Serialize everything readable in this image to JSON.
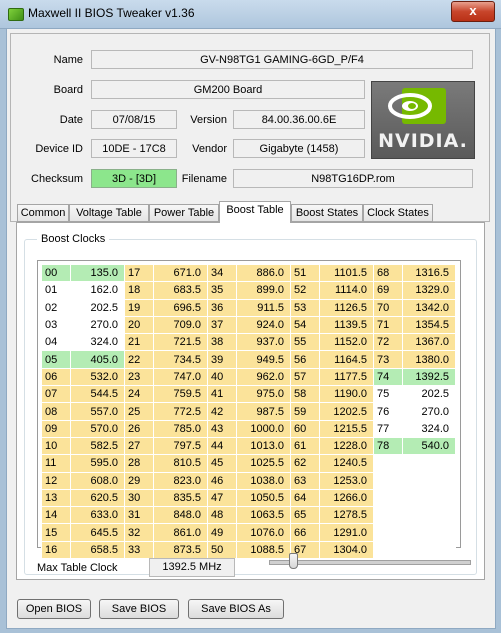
{
  "window": {
    "title": "Maxwell II BIOS Tweaker v1.36",
    "close_glyph": "x"
  },
  "info": {
    "name_label": "Name",
    "name_value": "GV-N98TG1 GAMING-6GD_P/F4",
    "board_label": "Board",
    "board_value": "GM200 Board",
    "date_label": "Date",
    "date_value": "07/08/15",
    "version_label": "Version",
    "version_value": "84.00.36.00.6E",
    "device_id_label": "Device ID",
    "device_id_value": "10DE - 17C8",
    "vendor_label": "Vendor",
    "vendor_value": "Gigabyte (1458)",
    "checksum_label": "Checksum",
    "checksum_value": "3D - [3D]",
    "filename_label": "Filename",
    "filename_value": "N98TG16DP.rom",
    "logo_text": "NVIDIA."
  },
  "tabs": [
    {
      "label": "Common"
    },
    {
      "label": "Voltage Table"
    },
    {
      "label": "Power Table"
    },
    {
      "label": "Boost Table",
      "active": true
    },
    {
      "label": "Boost States"
    },
    {
      "label": "Clock States"
    }
  ],
  "boost_table": {
    "group_title": "Boost Clocks",
    "rows": [
      [
        [
          "00",
          "135.0",
          "g"
        ],
        [
          "17",
          "671.0",
          "y"
        ],
        [
          "34",
          "886.0",
          "y"
        ],
        [
          "51",
          "1101.5",
          "y"
        ],
        [
          "68",
          "1316.5",
          "y"
        ]
      ],
      [
        [
          "01",
          "162.0",
          "w"
        ],
        [
          "18",
          "683.5",
          "y"
        ],
        [
          "35",
          "899.0",
          "y"
        ],
        [
          "52",
          "1114.0",
          "y"
        ],
        [
          "69",
          "1329.0",
          "y"
        ]
      ],
      [
        [
          "02",
          "202.5",
          "w"
        ],
        [
          "19",
          "696.5",
          "y"
        ],
        [
          "36",
          "911.5",
          "y"
        ],
        [
          "53",
          "1126.5",
          "y"
        ],
        [
          "70",
          "1342.0",
          "y"
        ]
      ],
      [
        [
          "03",
          "270.0",
          "w"
        ],
        [
          "20",
          "709.0",
          "y"
        ],
        [
          "37",
          "924.0",
          "y"
        ],
        [
          "54",
          "1139.5",
          "y"
        ],
        [
          "71",
          "1354.5",
          "y"
        ]
      ],
      [
        [
          "04",
          "324.0",
          "w"
        ],
        [
          "21",
          "721.5",
          "y"
        ],
        [
          "38",
          "937.0",
          "y"
        ],
        [
          "55",
          "1152.0",
          "y"
        ],
        [
          "72",
          "1367.0",
          "y"
        ]
      ],
      [
        [
          "05",
          "405.0",
          "g"
        ],
        [
          "22",
          "734.5",
          "y"
        ],
        [
          "39",
          "949.5",
          "y"
        ],
        [
          "56",
          "1164.5",
          "y"
        ],
        [
          "73",
          "1380.0",
          "y"
        ]
      ],
      [
        [
          "06",
          "532.0",
          "y"
        ],
        [
          "23",
          "747.0",
          "y"
        ],
        [
          "40",
          "962.0",
          "y"
        ],
        [
          "57",
          "1177.5",
          "y"
        ],
        [
          "74",
          "1392.5",
          "g"
        ]
      ],
      [
        [
          "07",
          "544.5",
          "y"
        ],
        [
          "24",
          "759.5",
          "y"
        ],
        [
          "41",
          "975.0",
          "y"
        ],
        [
          "58",
          "1190.0",
          "y"
        ],
        [
          "75",
          "202.5",
          "w"
        ]
      ],
      [
        [
          "08",
          "557.0",
          "y"
        ],
        [
          "25",
          "772.5",
          "y"
        ],
        [
          "42",
          "987.5",
          "y"
        ],
        [
          "59",
          "1202.5",
          "y"
        ],
        [
          "76",
          "270.0",
          "w"
        ]
      ],
      [
        [
          "09",
          "570.0",
          "y"
        ],
        [
          "26",
          "785.0",
          "y"
        ],
        [
          "43",
          "1000.0",
          "y"
        ],
        [
          "60",
          "1215.5",
          "y"
        ],
        [
          "77",
          "324.0",
          "w"
        ]
      ],
      [
        [
          "10",
          "582.5",
          "y"
        ],
        [
          "27",
          "797.5",
          "y"
        ],
        [
          "44",
          "1013.0",
          "y"
        ],
        [
          "61",
          "1228.0",
          "y"
        ],
        [
          "78",
          "540.0",
          "g"
        ]
      ],
      [
        [
          "11",
          "595.0",
          "y"
        ],
        [
          "28",
          "810.5",
          "y"
        ],
        [
          "45",
          "1025.5",
          "y"
        ],
        [
          "62",
          "1240.5",
          "y"
        ],
        [
          "",
          "",
          "w"
        ]
      ],
      [
        [
          "12",
          "608.0",
          "y"
        ],
        [
          "29",
          "823.0",
          "y"
        ],
        [
          "46",
          "1038.0",
          "y"
        ],
        [
          "63",
          "1253.0",
          "y"
        ],
        [
          "",
          "",
          "w"
        ]
      ],
      [
        [
          "13",
          "620.5",
          "y"
        ],
        [
          "30",
          "835.5",
          "y"
        ],
        [
          "47",
          "1050.5",
          "y"
        ],
        [
          "64",
          "1266.0",
          "y"
        ],
        [
          "",
          "",
          "w"
        ]
      ],
      [
        [
          "14",
          "633.0",
          "y"
        ],
        [
          "31",
          "848.0",
          "y"
        ],
        [
          "48",
          "1063.5",
          "y"
        ],
        [
          "65",
          "1278.5",
          "y"
        ],
        [
          "",
          "",
          "w"
        ]
      ],
      [
        [
          "15",
          "645.5",
          "y"
        ],
        [
          "32",
          "861.0",
          "y"
        ],
        [
          "49",
          "1076.0",
          "y"
        ],
        [
          "66",
          "1291.0",
          "y"
        ],
        [
          "",
          "",
          "w"
        ]
      ],
      [
        [
          "16",
          "658.5",
          "y"
        ],
        [
          "33",
          "873.5",
          "y"
        ],
        [
          "50",
          "1088.5",
          "y"
        ],
        [
          "67",
          "1304.0",
          "y"
        ],
        [
          "",
          "",
          "w"
        ]
      ]
    ],
    "max_clock_label": "Max Table Clock",
    "max_clock_value": "1392.5 MHz",
    "slider_value_fraction": 0.1
  },
  "buttons": {
    "open": "Open BIOS",
    "save": "Save BIOS",
    "save_as": "Save BIOS As"
  },
  "colors": {
    "yellow": "#fbe39a",
    "green": "#b4ecb4",
    "checksum_green": "#8ce68c"
  }
}
